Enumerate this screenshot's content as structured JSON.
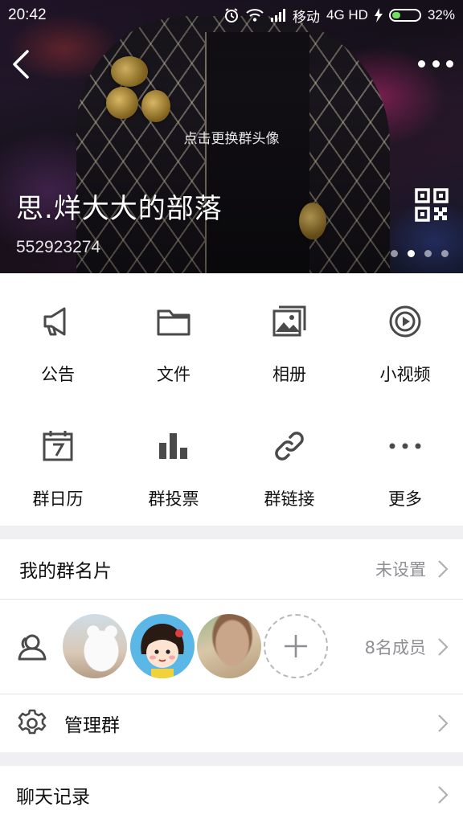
{
  "status_bar": {
    "time": "20:42",
    "carrier": "移动",
    "network": "4G HD",
    "battery": "32%",
    "battery_level": 0.32,
    "icons": [
      "alarm-icon",
      "wifi-icon",
      "signal-icon",
      "charging-icon",
      "battery-icon"
    ]
  },
  "header": {
    "change_avatar": "点击更换群头像",
    "group_name": "思.烊大大的部落",
    "group_id": "552923274",
    "page_dots": {
      "count": 4,
      "active_index": 1
    },
    "icons": [
      "back-icon",
      "more-icon",
      "qr-code-icon"
    ]
  },
  "features": {
    "row1": [
      {
        "label": "公告",
        "icon": "announcement-icon"
      },
      {
        "label": "文件",
        "icon": "folder-icon"
      },
      {
        "label": "相册",
        "icon": "album-icon"
      },
      {
        "label": "小视频",
        "icon": "short-video-icon"
      }
    ],
    "row2": [
      {
        "label": "群日历",
        "icon": "calendar-icon"
      },
      {
        "label": "群投票",
        "icon": "vote-icon"
      },
      {
        "label": "群链接",
        "icon": "link-icon"
      },
      {
        "label": "更多",
        "icon": "more-dots-icon"
      }
    ]
  },
  "group_card": {
    "label": "我的群名片",
    "value": "未设置"
  },
  "members": {
    "count_text": "8名成员",
    "icon": "members-icon"
  },
  "manage": {
    "label": "管理群",
    "icon": "gear-icon"
  },
  "chat_history": {
    "label": "聊天记录"
  },
  "colors": {
    "icon_gray": "#4a4a4a",
    "text_secondary": "#8e8e93",
    "divider": "#e2e2e4",
    "background": "#f0f0f2"
  }
}
